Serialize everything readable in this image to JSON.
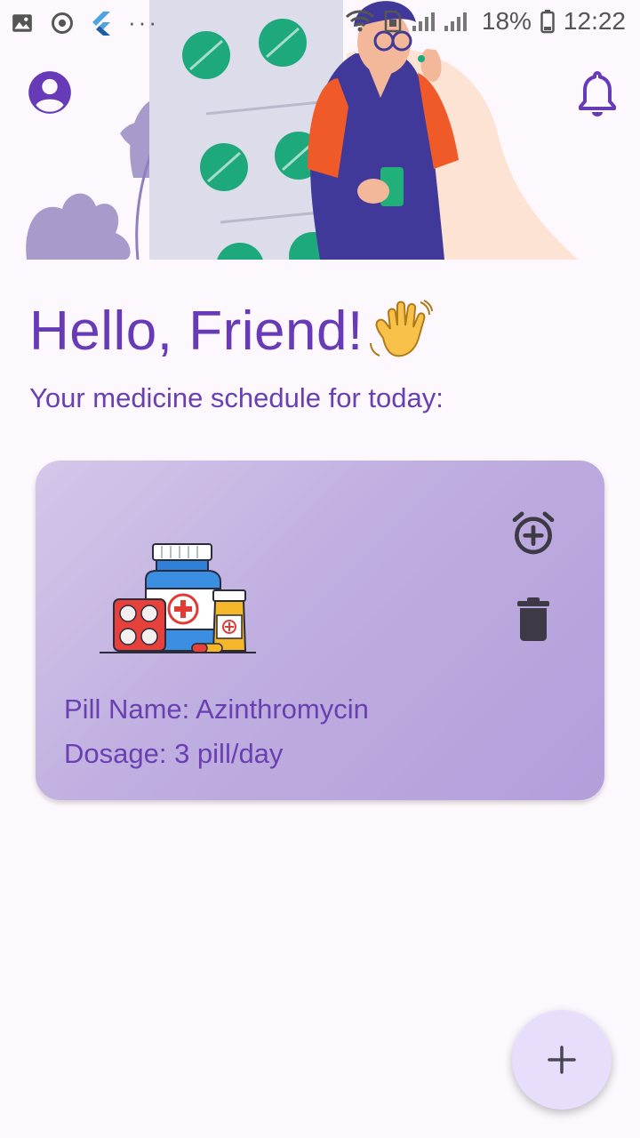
{
  "status_bar": {
    "battery_percent": "18%",
    "time": "12:22",
    "icons": [
      "image-icon",
      "sync-icon",
      "flutter-icon",
      "more-icon",
      "wifi-icon",
      "sim-icon",
      "signal-icon",
      "battery-icon"
    ]
  },
  "header": {
    "profile_icon": "account-circle-icon",
    "notifications_icon": "bell-icon"
  },
  "greeting": {
    "title": "Hello, Friend!",
    "subtitle": "Your medicine schedule for today:"
  },
  "medicines": [
    {
      "name_line": "Pill Name: Azinthromycin",
      "dosage_line": "Dosage: 3 pill/day",
      "actions": [
        "alarm-add-icon",
        "delete-icon"
      ]
    }
  ],
  "fab": {
    "icon": "plus-icon"
  },
  "colors": {
    "accent": "#673ab7",
    "card_start": "#d4c7e9",
    "card_end": "#b39edb",
    "fab_bg": "#e8ddfb",
    "background": "#fdf8fd"
  }
}
